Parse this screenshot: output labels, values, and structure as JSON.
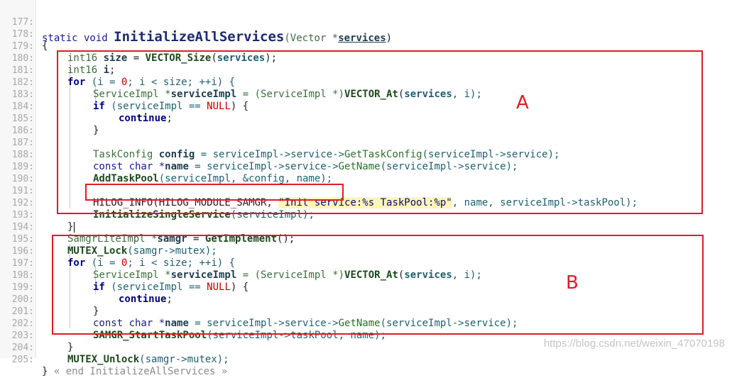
{
  "lines": {
    "l177": {
      "num": "177:",
      "t1": "static void ",
      "t2": "InitializeAllServices",
      "t3": "(Vector *",
      "t4": "services",
      "t5": ")"
    },
    "l178": {
      "num": "178:",
      "t1": "{"
    },
    "l179": {
      "num": "179:",
      "t1": "int16 ",
      "t2": "size",
      "t3": " = ",
      "t4": "VECTOR_Size",
      "t5": "(",
      "t6": "services",
      "t7": ");"
    },
    "l180": {
      "num": "180:",
      "t1": "int16 ",
      "t2": "i",
      "t3": ";"
    },
    "l181": {
      "num": "181:",
      "t1": "for",
      "t2": " (i = ",
      "t3": "0",
      "t4": "; i < size; ++i) {"
    },
    "l182": {
      "num": "182:",
      "t1": "ServiceImpl *",
      "t2": "serviceImpl",
      "t3": " = (ServiceImpl *)",
      "t4": "VECTOR_At",
      "t5": "(",
      "t6": "services",
      "t7": ", i);"
    },
    "l183": {
      "num": "183:",
      "t1": "if",
      "t2": " (serviceImpl == ",
      "t3": "NULL",
      "t4": ") {"
    },
    "l184": {
      "num": "184:",
      "t1": "continue",
      "t2": ";"
    },
    "l185": {
      "num": "185:",
      "t1": "}"
    },
    "l186": {
      "num": "186:"
    },
    "l187": {
      "num": "187:",
      "t1": "TaskConfig ",
      "t2": "config",
      "t3": " = serviceImpl->service->",
      "t4": "GetTaskConfig",
      "t5": "(serviceImpl->service);"
    },
    "l188": {
      "num": "188:",
      "t1": "const char *",
      "t2": "name",
      "t3": " = serviceImpl->service->",
      "t4": "GetName",
      "t5": "(serviceImpl->service);"
    },
    "l189": {
      "num": "189:",
      "t1": "AddTaskPool",
      "t2": "(serviceImpl, &config, name);"
    },
    "l190": {
      "num": "190:"
    },
    "l191": {
      "num": "191:",
      "t1": "HILOG_INFO(HILOG_MODULE_SAMGR, ",
      "t2": "\"Init service:%s TaskPool:%p\"",
      "t3": ", name, serviceImpl->taskPool);"
    },
    "l192": {
      "num": "192:",
      "t1": "InitializeSingleService",
      "t2": "(serviceImpl);"
    },
    "l193": {
      "num": "193:",
      "t1": "}"
    },
    "l194": {
      "num": "194:",
      "t1": "SamgrLiteImpl *",
      "t2": "samgr",
      "t3": " = ",
      "t4": "GetImplement",
      "t5": "();"
    },
    "l195": {
      "num": "195:",
      "t1": "MUTEX_Lock",
      "t2": "(samgr->mutex);"
    },
    "l196": {
      "num": "196:",
      "t1": "for",
      "t2": " (i = ",
      "t3": "0",
      "t4": "; i < size; ++i) {"
    },
    "l197": {
      "num": "197:",
      "t1": "ServiceImpl *",
      "t2": "serviceImpl",
      "t3": " = (ServiceImpl *)",
      "t4": "VECTOR_At",
      "t5": "(",
      "t6": "services",
      "t7": ", i);"
    },
    "l198": {
      "num": "198:",
      "t1": "if",
      "t2": " (serviceImpl == ",
      "t3": "NULL",
      "t4": ") {"
    },
    "l199": {
      "num": "199:",
      "t1": "continue",
      "t2": ";"
    },
    "l200": {
      "num": "200:",
      "t1": "}"
    },
    "l201": {
      "num": "201:",
      "t1": "const char *",
      "t2": "name",
      "t3": " = serviceImpl->service->",
      "t4": "GetName",
      "t5": "(serviceImpl->service);"
    },
    "l202": {
      "num": "202:",
      "t1": "SAMGR_StartTaskPool",
      "t2": "(serviceImpl->taskPool, name);"
    },
    "l203": {
      "num": "203:",
      "t1": "}"
    },
    "l204": {
      "num": "204:",
      "t1": "MUTEX_Unlock",
      "t2": "(samgr->mutex);"
    },
    "l205": {
      "num": "205:",
      "t1": "} ",
      "t2": "« end InitializeAllServices »"
    }
  },
  "annotations": {
    "label_a": "A",
    "label_b": "B",
    "highlight_color": "#e01b24"
  },
  "watermark": "https://blog.csdn.net/weixin_47070198"
}
